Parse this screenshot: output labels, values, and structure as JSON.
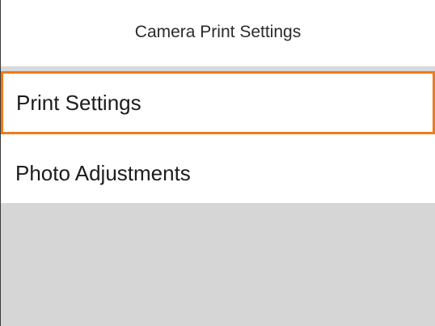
{
  "header": {
    "title": "Camera Print Settings"
  },
  "menu": {
    "items": [
      {
        "label": "Print Settings",
        "selected": true
      },
      {
        "label": "Photo Adjustments",
        "selected": false
      }
    ]
  },
  "colors": {
    "selection_border": "#f07a1a",
    "divider": "#d9d9d9",
    "empty_background": "#d6d6d6",
    "background": "#ffffff"
  }
}
